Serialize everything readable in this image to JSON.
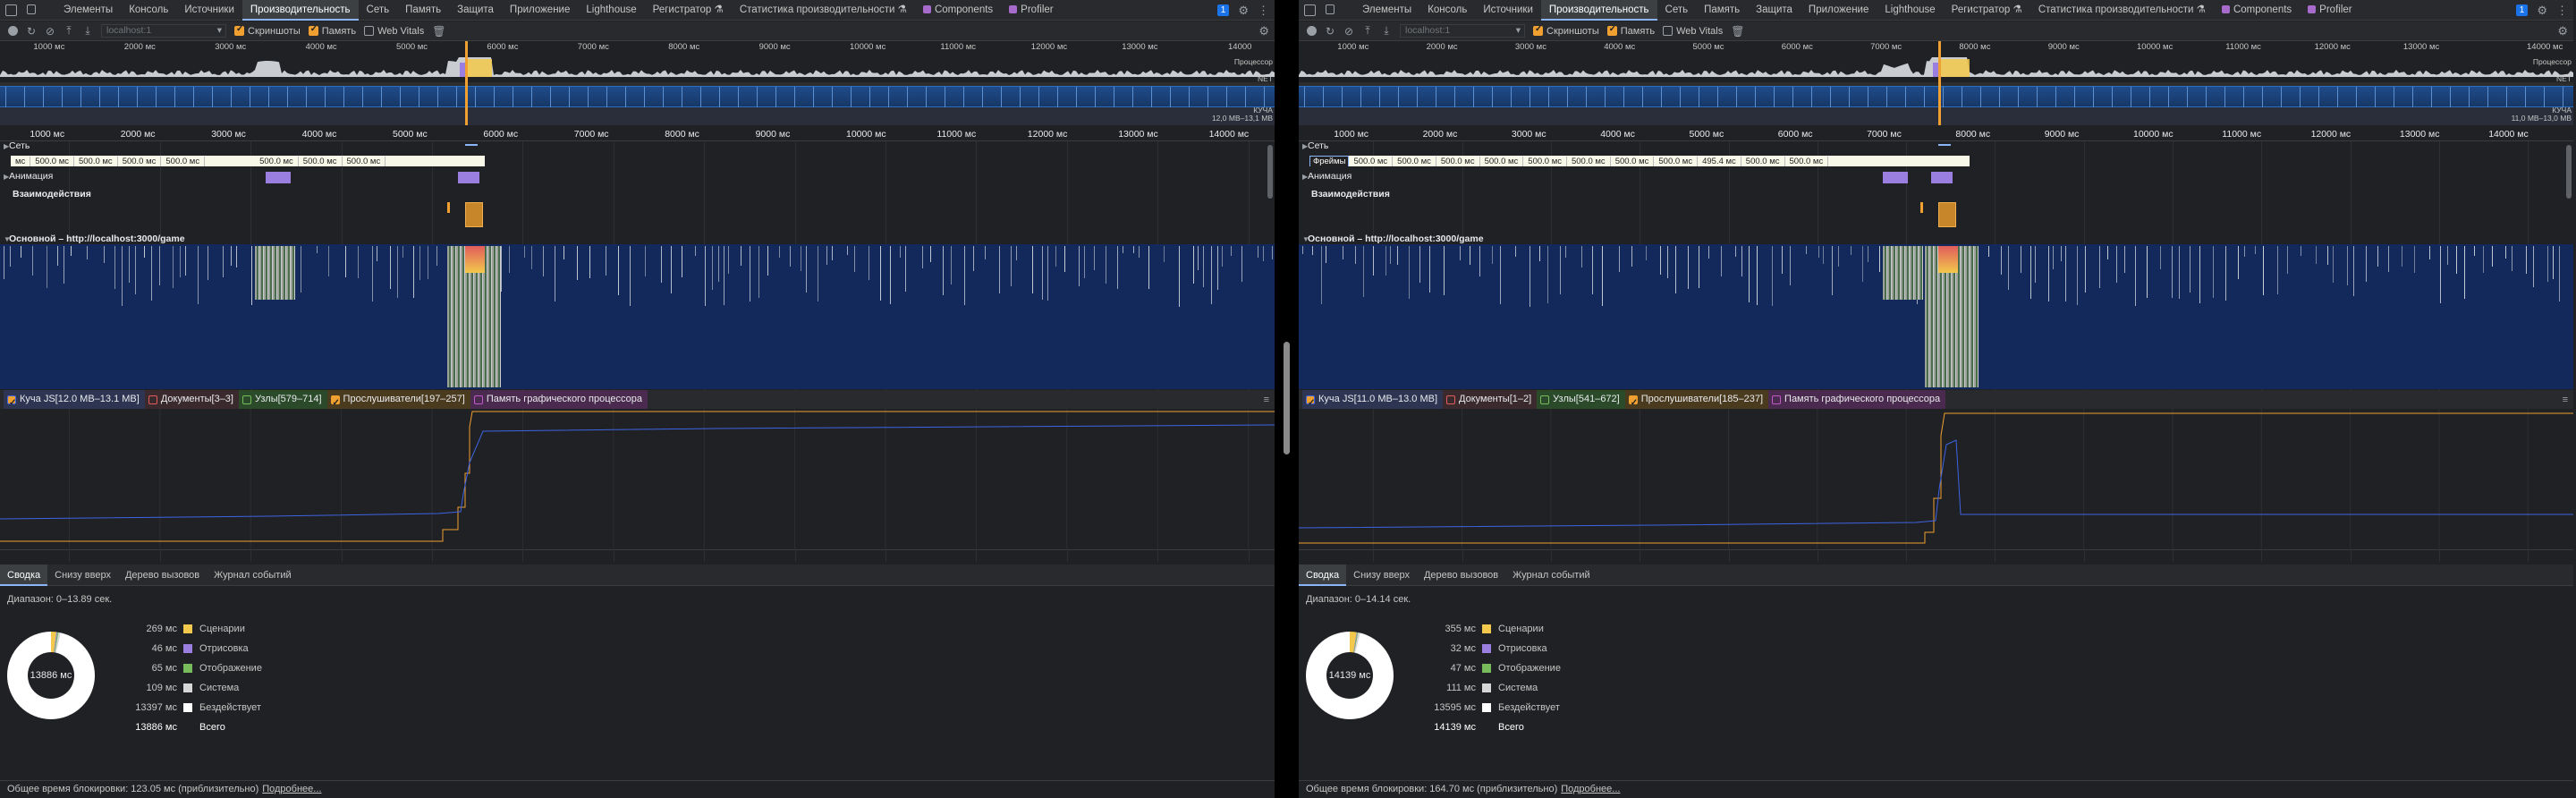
{
  "tabs": [
    "Элементы",
    "Консоль",
    "Источники",
    "Производительность",
    "Сеть",
    "Память",
    "Защита",
    "Приложение",
    "Lighthouse",
    "Регистратор ⚗",
    "Статистика производительности ⚗",
    "Components",
    "Profiler"
  ],
  "active_tab": "Производительность",
  "colors": {
    "scripting": "#f2c94c",
    "rendering": "#9b7fe0",
    "painting": "#77bb5c",
    "system": "#d6d6d6",
    "idle": "#ffffff",
    "heap": "#3d64e4",
    "listeners": "#f0a030",
    "accent": "#8ab4f8"
  },
  "toolbar": {
    "url_placeholder": "localhost:1",
    "screenshots": "Скриншоты",
    "memory": "Память",
    "web_vitals": "Web Vitals"
  },
  "overview_labels": {
    "cpu": "Процессор",
    "net": "NET",
    "heap": "КУЧА"
  },
  "tracks": {
    "network": "Сеть",
    "frames": "Фреймы",
    "animation": "Анимация",
    "interactions": "Взаимодействия"
  },
  "summary_tabs": [
    "Сводка",
    "Снизу вверх",
    "Дерево вызовов",
    "Журнал событий"
  ],
  "footer": {
    "link": "Подробнее..."
  },
  "panes": [
    {
      "badge": "1",
      "ov_ticks": [
        "1000 мс",
        "2000 мс",
        "3000 мс",
        "4000 мс",
        "5000 мс",
        "6000 мс",
        "7000 мс",
        "8000 мс",
        "9000 мс",
        "10000 мс",
        "11000 мс",
        "12000 мс",
        "13000 мс"
      ],
      "ov_last": "14000",
      "heap_range": "12,0 MB–13,1 MB",
      "ruler": [
        "1000 мс",
        "2000 мс",
        "3000 мс",
        "4000 мс",
        "5000 мс",
        "6000 мс",
        "7000 мс",
        "8000 мс",
        "9000 мс",
        "10000 мс",
        "11000 мс",
        "12000 мс",
        "13000 мс",
        "14000 мс"
      ],
      "frames": [
        "мс",
        "500.0 мс",
        "500.0 мс",
        "500.0 мс",
        "500.0 мс",
        "",
        "",
        "500.0 мс",
        "500.0 мс",
        "500.0 мс"
      ],
      "main_track": "Основной – http://localhost:3000/game",
      "counters": [
        {
          "label": "Куча JS[12.0 MB–13.1 MB]",
          "on": true
        },
        {
          "label": "Документы[3–3]",
          "on": false
        },
        {
          "label": "Узлы[579–714]",
          "on": false
        },
        {
          "label": "Прослушиватели[197–257]",
          "on": true
        },
        {
          "label": "Память графического процессора",
          "on": false
        }
      ],
      "range": "Диапазон: 0–13.89 сек.",
      "total_center": "13886 мс",
      "stats": [
        {
          "val": "269 мс",
          "name": "Сценарии"
        },
        {
          "val": "46 мс",
          "name": "Отрисовка"
        },
        {
          "val": "65 мс",
          "name": "Отображение"
        },
        {
          "val": "109 мс",
          "name": "Система"
        },
        {
          "val": "13397 мс",
          "name": "Бездействует"
        },
        {
          "val": "13886 мс",
          "name": "Всего"
        }
      ],
      "blocking": "Общее время блокировки: 123.05 мс (приблизительно)"
    },
    {
      "badge": "1",
      "ov_ticks": [
        "1000 мс",
        "2000 мс",
        "3000 мс",
        "4000 мс",
        "5000 мс",
        "6000 мс",
        "7000 мс",
        "8000 мс",
        "9000 мс",
        "10000 мс",
        "11000 мс",
        "12000 мс",
        "13000 мс"
      ],
      "ov_last": "14000 мс",
      "heap_range": "11,0 MB–13,0 MB",
      "ruler": [
        "1000 мс",
        "2000 мс",
        "3000 мс",
        "4000 мс",
        "5000 мс",
        "6000 мс",
        "7000 мс",
        "8000 мс",
        "9000 мс",
        "10000 мс",
        "11000 мс",
        "12000 мс",
        "13000 мс",
        "14000 мс"
      ],
      "frames": [
        "Фреймы",
        "500.0 мс",
        "500.0 мс",
        "500.0 мс",
        "500.0 мс",
        "500.0 мс",
        "500.0 мс",
        "500.0 мс",
        "500.0 мс",
        "495.4 мс",
        "500.0 мс",
        "500.0 мс",
        "",
        "",
        ""
      ],
      "main_track": "Основной – http://localhost:3000/game",
      "counters": [
        {
          "label": "Куча JS[11.0 MB–13.0 MB]",
          "on": true
        },
        {
          "label": "Документы[1–2]",
          "on": false
        },
        {
          "label": "Узлы[541–672]",
          "on": false
        },
        {
          "label": "Прослушиватели[185–237]",
          "on": true
        },
        {
          "label": "Память графического процессора",
          "on": false
        }
      ],
      "range": "Диапазон: 0–14.14 сек.",
      "total_center": "14139 мс",
      "stats": [
        {
          "val": "355 мс",
          "name": "Сценарии"
        },
        {
          "val": "32 мс",
          "name": "Отрисовка"
        },
        {
          "val": "47 мс",
          "name": "Отображение"
        },
        {
          "val": "111 мс",
          "name": "Система"
        },
        {
          "val": "13595 мс",
          "name": "Бездействует"
        },
        {
          "val": "14139 мс",
          "name": "Всего"
        }
      ],
      "blocking": "Общее время блокировки: 164.70 мс (приблизительно)"
    }
  ]
}
